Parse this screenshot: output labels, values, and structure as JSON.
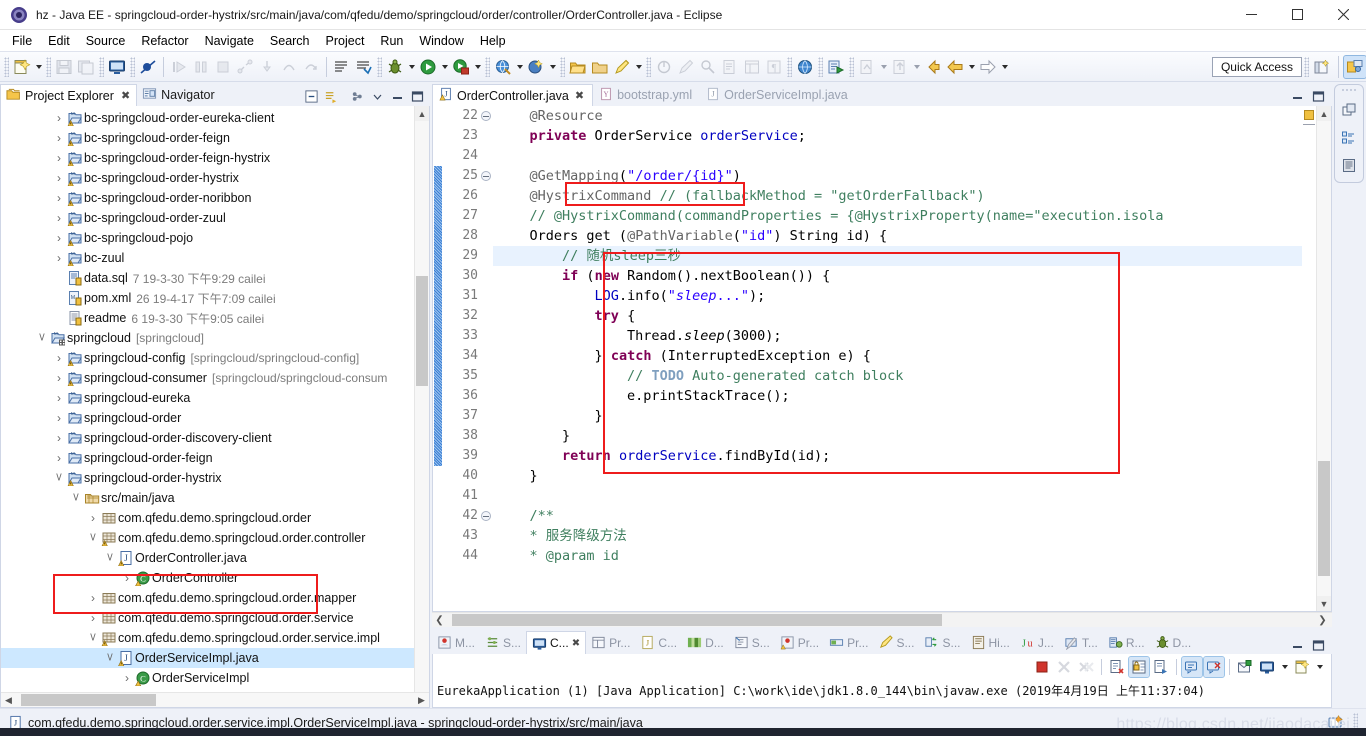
{
  "window": {
    "title": "hz - Java EE - springcloud-order-hystrix/src/main/java/com/qfedu/demo/springcloud/order/controller/OrderController.java - Eclipse",
    "minimize": "—",
    "maximize": "☐",
    "close": "✕"
  },
  "menubar": {
    "items": [
      {
        "label": "File"
      },
      {
        "label": "Edit"
      },
      {
        "label": "Source"
      },
      {
        "label": "Refactor"
      },
      {
        "label": "Navigate"
      },
      {
        "label": "Search"
      },
      {
        "label": "Project"
      },
      {
        "label": "Run"
      },
      {
        "label": "Window"
      },
      {
        "label": "Help"
      }
    ]
  },
  "toolbar": {
    "quick_access": "Quick Access"
  },
  "left_view": {
    "tabs": [
      {
        "label": "Project Explorer",
        "active": true,
        "close": "✖"
      },
      {
        "label": "Navigator",
        "active": false
      }
    ],
    "tree": [
      {
        "indent": 1,
        "twist": "›",
        "icon": "maven-project-warn",
        "label": "bc-springcloud-order-eureka-client"
      },
      {
        "indent": 1,
        "twist": "›",
        "icon": "maven-project-warn",
        "label": "bc-springcloud-order-feign"
      },
      {
        "indent": 1,
        "twist": "›",
        "icon": "maven-project-warn",
        "label": "bc-springcloud-order-feign-hystrix"
      },
      {
        "indent": 1,
        "twist": "›",
        "icon": "maven-project-warn",
        "label": "bc-springcloud-order-hystrix"
      },
      {
        "indent": 1,
        "twist": "›",
        "icon": "maven-project-warn",
        "label": "bc-springcloud-order-noribbon"
      },
      {
        "indent": 1,
        "twist": "›",
        "icon": "maven-project-warn",
        "label": "bc-springcloud-order-zuul"
      },
      {
        "indent": 1,
        "twist": "›",
        "icon": "maven-project-warn",
        "label": "bc-springcloud-pojo"
      },
      {
        "indent": 1,
        "twist": "›",
        "icon": "maven-project-warn",
        "label": "bc-zuul"
      },
      {
        "indent": 1,
        "twist": "",
        "icon": "sql-file",
        "label": "data.sql",
        "meta": "7   19-3-30 下午9:29   cailei"
      },
      {
        "indent": 1,
        "twist": "",
        "icon": "xml-file",
        "label": "pom.xml",
        "meta": "26   19-4-17 下午7:09   cailei"
      },
      {
        "indent": 1,
        "twist": "",
        "icon": "text-file",
        "label": "readme",
        "meta": "6   19-3-30 下午9:05   cailei"
      },
      {
        "indent": 0,
        "twist": "˅",
        "icon": "working-set",
        "label": "springcloud",
        "dim": "[springcloud]"
      },
      {
        "indent": 1,
        "twist": "›",
        "icon": "maven-project-warn",
        "label": "springcloud-config",
        "dim": "[springcloud/springcloud-config]"
      },
      {
        "indent": 1,
        "twist": "›",
        "icon": "maven-project-warn",
        "label": "springcloud-consumer",
        "dim": "[springcloud/springcloud-consum"
      },
      {
        "indent": 1,
        "twist": "›",
        "icon": "maven-project",
        "label": "springcloud-eureka"
      },
      {
        "indent": 1,
        "twist": "›",
        "icon": "maven-project",
        "label": "springcloud-order"
      },
      {
        "indent": 1,
        "twist": "›",
        "icon": "maven-project",
        "label": "springcloud-order-discovery-client"
      },
      {
        "indent": 1,
        "twist": "›",
        "icon": "maven-project",
        "label": "springcloud-order-feign"
      },
      {
        "indent": 1,
        "twist": "˅",
        "icon": "maven-project-warn",
        "label": "springcloud-order-hystrix"
      },
      {
        "indent": 2,
        "twist": "˅",
        "icon": "source-folder",
        "label": "src/main/java"
      },
      {
        "indent": 3,
        "twist": "›",
        "icon": "package",
        "label": "com.qfedu.demo.springcloud.order"
      },
      {
        "indent": 3,
        "twist": "˅",
        "icon": "package-warn",
        "label": "com.qfedu.demo.springcloud.order.controller"
      },
      {
        "indent": 4,
        "twist": "˅",
        "icon": "java-file-warn",
        "label": "OrderController.java"
      },
      {
        "indent": 5,
        "twist": "›",
        "icon": "java-class",
        "label": "OrderController"
      },
      {
        "indent": 3,
        "twist": "›",
        "icon": "package",
        "label": "com.qfedu.demo.springcloud.order.mapper"
      },
      {
        "indent": 3,
        "twist": "›",
        "icon": "package",
        "label": "com.qfedu.demo.springcloud.order.service"
      },
      {
        "indent": 3,
        "twist": "˅",
        "icon": "package-warn",
        "label": "com.qfedu.demo.springcloud.order.service.impl"
      },
      {
        "indent": 4,
        "twist": "˅",
        "icon": "java-file-warn",
        "label": "OrderServiceImpl.java",
        "selected": true
      },
      {
        "indent": 5,
        "twist": "›",
        "icon": "java-class",
        "label": "OrderServiceImpl"
      }
    ]
  },
  "editor": {
    "tabs": [
      {
        "label": "OrderController.java",
        "icon": "java-file-warn",
        "active": true,
        "close": "✖"
      },
      {
        "label": "bootstrap.yml",
        "icon": "yml-file",
        "active": false
      },
      {
        "label": "OrderServiceImpl.java",
        "icon": "java-file",
        "active": false
      }
    ],
    "first_line_number": 22,
    "lines": [
      {
        "n": 22,
        "fold": true,
        "text": "@Resource",
        "indent": 1
      },
      {
        "n": 23,
        "fold": false,
        "text": "private OrderService orderService;",
        "indent": 1
      },
      {
        "n": 24,
        "fold": false,
        "text": "",
        "indent": 0
      },
      {
        "n": 25,
        "fold": true,
        "text": "@GetMapping(\"/order/{id}\")",
        "indent": 1
      },
      {
        "n": 26,
        "fold": false,
        "text": "@HystrixCommand // (fallbackMethod = \"getOrderFallback\")",
        "indent": 1
      },
      {
        "n": 27,
        "fold": false,
        "text": "// @HystrixCommand(commandProperties = {@HystrixProperty(name=\"execution.isola",
        "indent": 1
      },
      {
        "n": 28,
        "fold": false,
        "text": "Orders get (@PathVariable(\"id\") String id) {",
        "indent": 1
      },
      {
        "n": 29,
        "fold": false,
        "text": "// 随机sleep三秒",
        "indent": 2,
        "highlight": true
      },
      {
        "n": 30,
        "fold": false,
        "text": "if (new Random().nextBoolean()) {",
        "indent": 2
      },
      {
        "n": 31,
        "fold": false,
        "text": "LOG.info(\"sleep...\");",
        "indent": 3
      },
      {
        "n": 32,
        "fold": false,
        "text": "try {",
        "indent": 3
      },
      {
        "n": 33,
        "fold": false,
        "text": "Thread.sleep(3000);",
        "indent": 4
      },
      {
        "n": 34,
        "fold": false,
        "text": "} catch (InterruptedException e) {",
        "indent": 3
      },
      {
        "n": 35,
        "fold": false,
        "text": "// TODO Auto-generated catch block",
        "indent": 4
      },
      {
        "n": 36,
        "fold": false,
        "text": "e.printStackTrace();",
        "indent": 4
      },
      {
        "n": 37,
        "fold": false,
        "text": "}",
        "indent": 3
      },
      {
        "n": 38,
        "fold": false,
        "text": "}",
        "indent": 2
      },
      {
        "n": 39,
        "fold": false,
        "text": "return orderService.findById(id);",
        "indent": 2
      },
      {
        "n": 40,
        "fold": false,
        "text": "}",
        "indent": 1
      },
      {
        "n": 41,
        "fold": false,
        "text": "",
        "indent": 0
      },
      {
        "n": 42,
        "fold": true,
        "text": "/**",
        "indent": 1
      },
      {
        "n": 43,
        "fold": false,
        "text": "* 服务降级方法",
        "indent": 1
      },
      {
        "n": 44,
        "fold": false,
        "text": "* @param id",
        "indent": 1
      }
    ]
  },
  "console": {
    "tabs": [
      {
        "label": "M...",
        "icon": "markers-icon",
        "active": false
      },
      {
        "label": "S...",
        "icon": "servers-icon",
        "active": false
      },
      {
        "label": "C...",
        "icon": "console-icon",
        "active": true,
        "close": "✖"
      },
      {
        "label": "Pr...",
        "icon": "properties-icon",
        "active": false
      },
      {
        "label": "C...",
        "icon": "coverage-icon",
        "active": false
      },
      {
        "label": "D...",
        "icon": "data-source-icon",
        "active": false
      },
      {
        "label": "S...",
        "icon": "snippets-icon",
        "active": false
      },
      {
        "label": "Pr...",
        "icon": "problems-icon",
        "active": false
      },
      {
        "label": "Pr...",
        "icon": "progress-icon",
        "active": false
      },
      {
        "label": "S...",
        "icon": "search-icon",
        "active": false
      },
      {
        "label": "S...",
        "icon": "synchronize-icon",
        "active": false
      },
      {
        "label": "Hi...",
        "icon": "history-icon",
        "active": false
      },
      {
        "label": "J...",
        "icon": "junit-icon",
        "active": false
      },
      {
        "label": "T...",
        "icon": "terminal-icon",
        "active": false
      },
      {
        "label": "R...",
        "icon": "repositories-icon",
        "active": false
      },
      {
        "label": "D...",
        "icon": "debug-icon",
        "active": false
      }
    ],
    "output": "EurekaApplication (1) [Java Application] C:\\work\\ide\\jdk1.8.0_144\\bin\\javaw.exe (2019年4月19日 上午11:37:04)"
  },
  "statusbar": {
    "text": "com.qfedu.demo.springcloud.order.service.impl.OrderServiceImpl.java - springcloud-order-hystrix/src/main/java",
    "watermark": "https://blog.csdn.net/jiaodacailei"
  },
  "colors": {
    "accent": "#3b7fd4",
    "red_highlight": "#ee1c1c",
    "selection": "#cde8ff",
    "keyword": "#7f0055",
    "string": "#2a00ff",
    "comment": "#3f7f5f",
    "annotation": "#646464",
    "field": "#0000c0"
  }
}
